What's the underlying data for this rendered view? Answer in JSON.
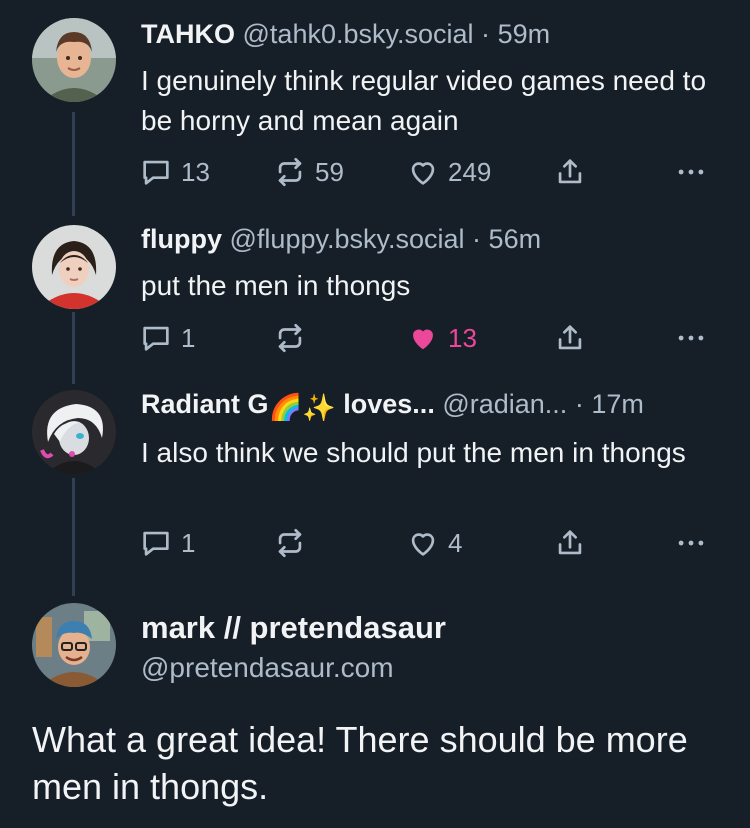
{
  "posts": [
    {
      "display_name": "TAHKO",
      "handle": "@tahk0.bsky.social",
      "separator": "·",
      "time": "59m",
      "text": "I genuinely think regular video games need to be horny and mean again",
      "replies": "13",
      "reposts": "59",
      "likes": "249",
      "liked": false
    },
    {
      "display_name": "fluppy",
      "handle": "@fluppy.bsky.social",
      "separator": "·",
      "time": "56m",
      "text": "put the men in thongs",
      "replies": "1",
      "reposts": "",
      "likes": "13",
      "liked": true
    },
    {
      "display_name": "Radiant G",
      "name_emoji": "🌈✨",
      "name_suffix": " loves...",
      "handle": "@radian...",
      "separator": "·",
      "time": "17m",
      "text": "I also think we should put the men in thongs",
      "replies": "1",
      "reposts": "",
      "likes": "4",
      "liked": false
    }
  ],
  "main_post": {
    "display_name": "mark // pretendasaur",
    "handle": "@pretendasaur.com",
    "text": "What a great idea! There should be more men in thongs."
  },
  "icons": {
    "reply": "reply-icon",
    "repost": "repost-icon",
    "like": "heart-icon",
    "share": "share-icon",
    "more": "more-icon"
  },
  "colors": {
    "background": "#161e27",
    "text": "#f1f3f5",
    "muted": "#aebbc9",
    "like_active": "#ec4899",
    "thread_line": "#2e4052"
  }
}
